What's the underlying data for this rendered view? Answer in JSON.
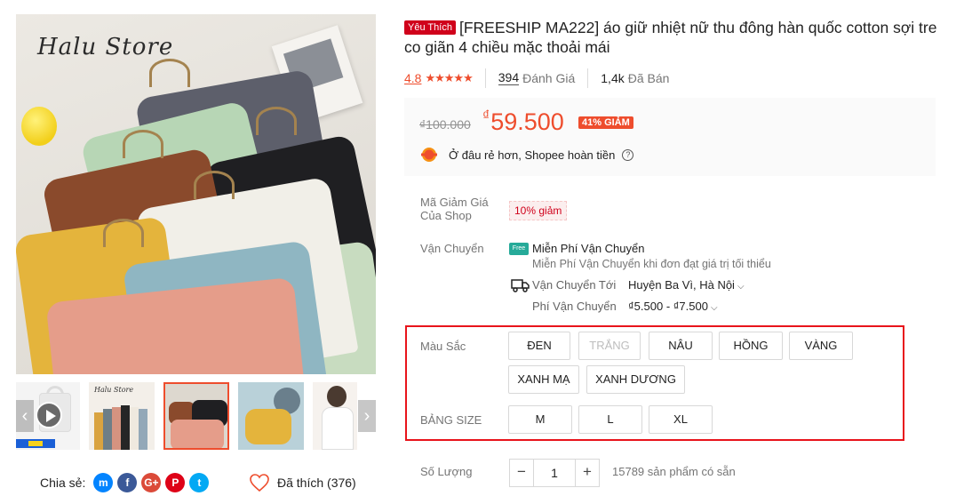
{
  "gallery": {
    "brand_watermark": "Halu Store",
    "thumb_brand": "Halu Store",
    "prev_arrow": "‹",
    "next_arrow": "›",
    "icons": [
      "shopping-bag-icon",
      "play-icon",
      "chevron-left-icon",
      "chevron-right-icon"
    ]
  },
  "share": {
    "label": "Chia sẻ:",
    "networks": [
      {
        "name": "messenger",
        "glyph": "m",
        "color": "#0384ff"
      },
      {
        "name": "facebook",
        "glyph": "f",
        "color": "#3b5998"
      },
      {
        "name": "google-plus",
        "glyph": "G+",
        "color": "#db4a39"
      },
      {
        "name": "pinterest",
        "glyph": "P",
        "color": "#de0217"
      },
      {
        "name": "twitter",
        "glyph": "t",
        "color": "#03a9f4"
      }
    ]
  },
  "favorite": {
    "label": "Đã thích (376)"
  },
  "product": {
    "badge": "Yêu Thích",
    "title": "[FREESHIP MA222] áo giữ nhiệt nữ thu đông hàn quốc cotton sợi tre co giãn 4 chiều mặc thoải mái",
    "rating": "4.8",
    "stars": "★★★★★",
    "reviews_count": "394",
    "reviews_label": "Đánh Giá",
    "sold_count": "1,4k",
    "sold_label": "Đã Bán"
  },
  "price": {
    "old": "₫100.000",
    "currency": "₫",
    "new": "59.500",
    "discount": "41% GIẢM",
    "refund_text": "Ở đâu rẻ hơn, Shopee hoàn tiền",
    "help_glyph": "?"
  },
  "voucher": {
    "label": "Mã Giảm Giá Của Shop",
    "tag": "10% giảm"
  },
  "shipping": {
    "label": "Vận Chuyển",
    "freeship_badge": "Free",
    "free_title": "Miễn Phí Vận Chuyển",
    "free_subtitle": "Miễn Phí Vận Chuyển khi đơn đạt giá trị tối thiểu",
    "to_label": "Vận Chuyển Tới",
    "to_value": "Huyện Ba Vì, Hà Nội",
    "fee_label": "Phí Vận Chuyển",
    "fee_value": "₫5.500 - ₫7.500",
    "chevron": "⌵"
  },
  "variations": {
    "color_label": "Màu Sắc",
    "colors": [
      {
        "label": "ĐEN",
        "disabled": false
      },
      {
        "label": "TRẮNG",
        "disabled": true
      },
      {
        "label": "NÂU",
        "disabled": false
      },
      {
        "label": "HỒNG",
        "disabled": false
      },
      {
        "label": "VÀNG",
        "disabled": false
      },
      {
        "label": "XANH MẠ",
        "disabled": false
      },
      {
        "label": "XANH DƯƠNG",
        "disabled": false
      }
    ],
    "size_label": "BẢNG SIZE",
    "sizes": [
      {
        "label": "M"
      },
      {
        "label": "L"
      },
      {
        "label": "XL"
      }
    ],
    "highlight_color": "#e8141b"
  },
  "quantity": {
    "label": "Số Lượng",
    "minus": "−",
    "value": "1",
    "plus": "+",
    "stock": "15789 sản phẩm có sẵn"
  },
  "colors": {
    "accent": "#ee4d2d",
    "badge": "#d0011b",
    "freeship": "#26aa99"
  }
}
